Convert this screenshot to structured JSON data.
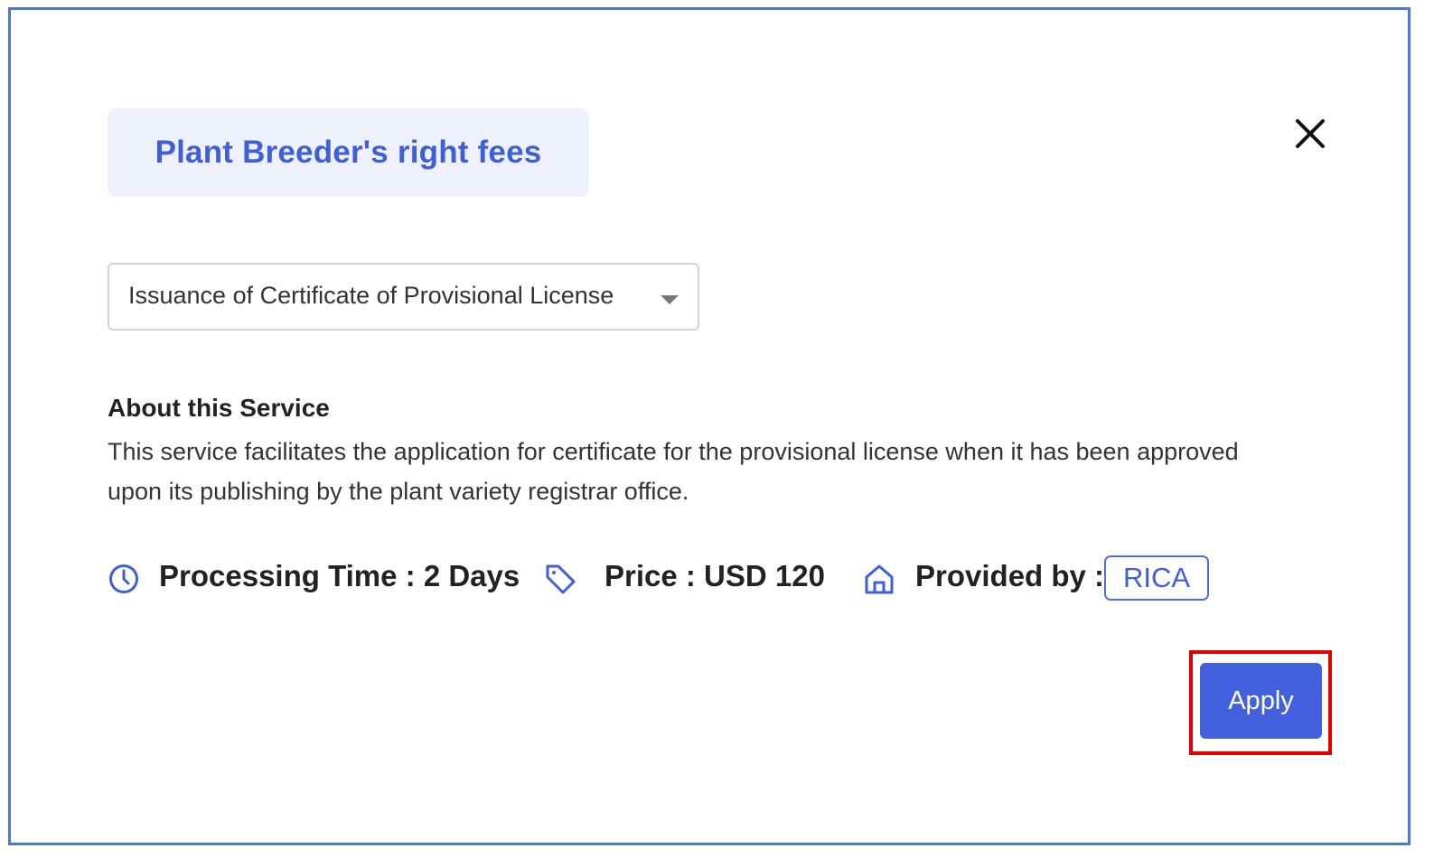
{
  "dialog": {
    "title": "Plant Breeder's right fees",
    "close_icon": "close-icon"
  },
  "service_select": {
    "selected": "Issuance of Certificate of Provisional License",
    "caret_icon": "caret-down-icon"
  },
  "about": {
    "heading": "About this Service",
    "body": "This service facilitates the application for certificate for the provisional license when it has been approved upon its publishing by the plant variety registrar office."
  },
  "meta": {
    "processing_time": "Processing Time : 2 Days",
    "price": "Price : USD 120",
    "provided_by_label": "Provided by :",
    "provider": "RICA",
    "icons": [
      "clock-icon",
      "price-tag-icon",
      "home-icon"
    ]
  },
  "actions": {
    "apply_label": "Apply"
  },
  "colors": {
    "accent": "#3f5fd8",
    "button": "#4360de",
    "title_background": "#eef1fc",
    "frame_border": "#4a78d2",
    "highlight": "#e00000"
  }
}
